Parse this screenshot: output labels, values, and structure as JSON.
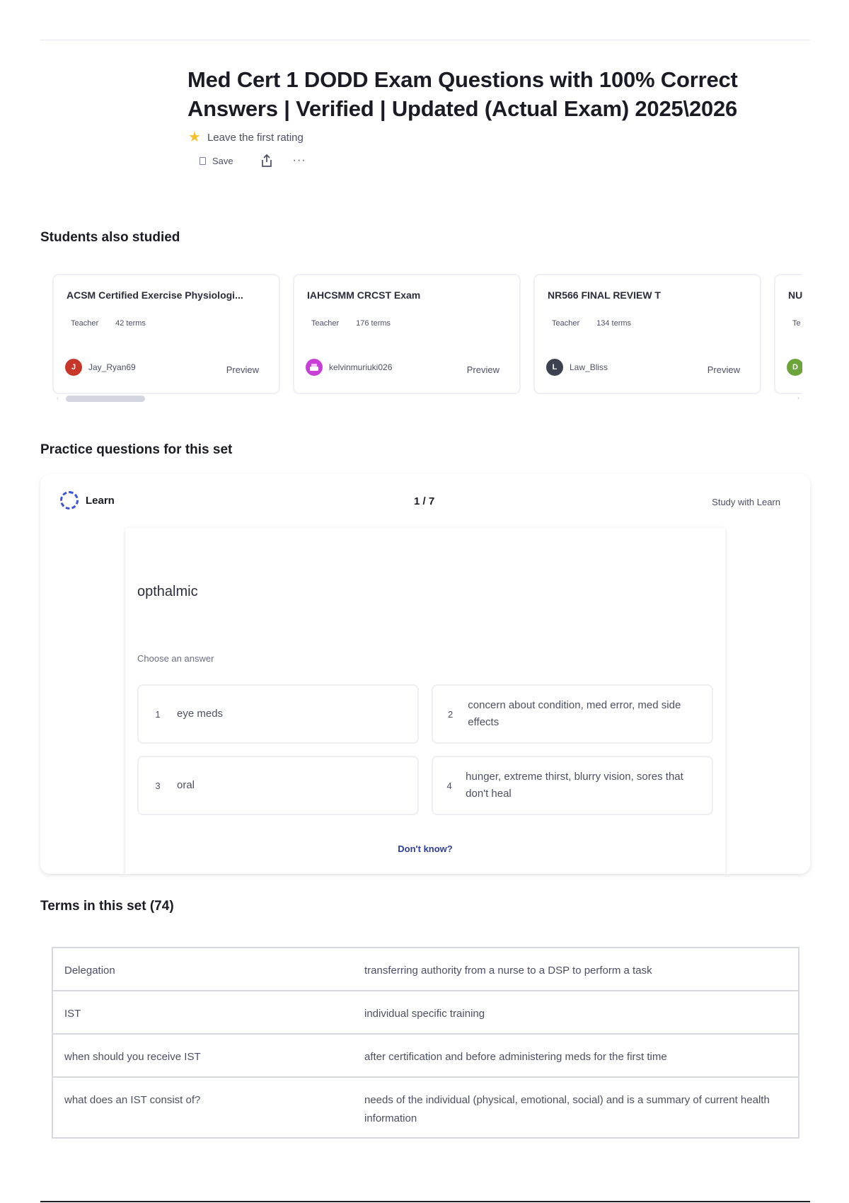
{
  "header": {
    "title": "Med Cert 1 DODD Exam Questions with 100% Correct Answers | Verified | Updated (Actual Exam) 2025\\2026",
    "rating_text": "Leave the first rating",
    "save_label": "Save",
    "more_label": "···"
  },
  "students_also_studied": {
    "heading": "Students also studied",
    "cards": [
      {
        "title": "ACSM Certified Exercise Physiologi...",
        "role": "Teacher",
        "terms": "42 terms",
        "user": "Jay_Ryan69",
        "avatar_letter": "J",
        "avatar_color": "#c8362a",
        "preview": "Preview"
      },
      {
        "title": "IAHCSMM CRCST Exam",
        "role": "Teacher",
        "terms": "176 terms",
        "user": "kelvinmuriuki026",
        "avatar_letter": "",
        "avatar_color": "#c93ed6",
        "preview": "Preview"
      },
      {
        "title": "NR566 FINAL REVIEW T",
        "role": "Teacher",
        "terms": "134 terms",
        "user": "Law_Bliss",
        "avatar_letter": "L",
        "avatar_color": "#3c4250",
        "preview": "Preview"
      },
      {
        "title": "NU",
        "role": "Te",
        "terms": "",
        "user": "",
        "avatar_letter": "D",
        "avatar_color": "#6ba53a",
        "preview": ""
      }
    ]
  },
  "practice": {
    "heading": "Practice questions for this set",
    "learn_label": "Learn",
    "progress": "1 / 7",
    "study_link": "Study with Learn",
    "prompt": "opthalmic",
    "choose_label": "Choose an answer",
    "options": [
      {
        "num": "1",
        "text": "eye meds"
      },
      {
        "num": "2",
        "text": "concern about condition, med error, med side effects"
      },
      {
        "num": "3",
        "text": "oral"
      },
      {
        "num": "4",
        "text": "hunger, extreme thirst, blurry vision, sores that don't heal"
      }
    ],
    "dont_know": "Don't know?"
  },
  "terms": {
    "heading": "Terms in this set (74)",
    "rows": [
      {
        "term": "Delegation",
        "definition": "transferring authority from a nurse to a DSP to perform a task"
      },
      {
        "term": "IST",
        "definition": "individual specific training"
      },
      {
        "term": "when should you receive IST",
        "definition": "after certification and before administering meds for the first time"
      },
      {
        "term": "what does an IST consist of?",
        "definition": "needs of the individual (physical, emotional, social) and is a summary of current health information"
      }
    ]
  }
}
